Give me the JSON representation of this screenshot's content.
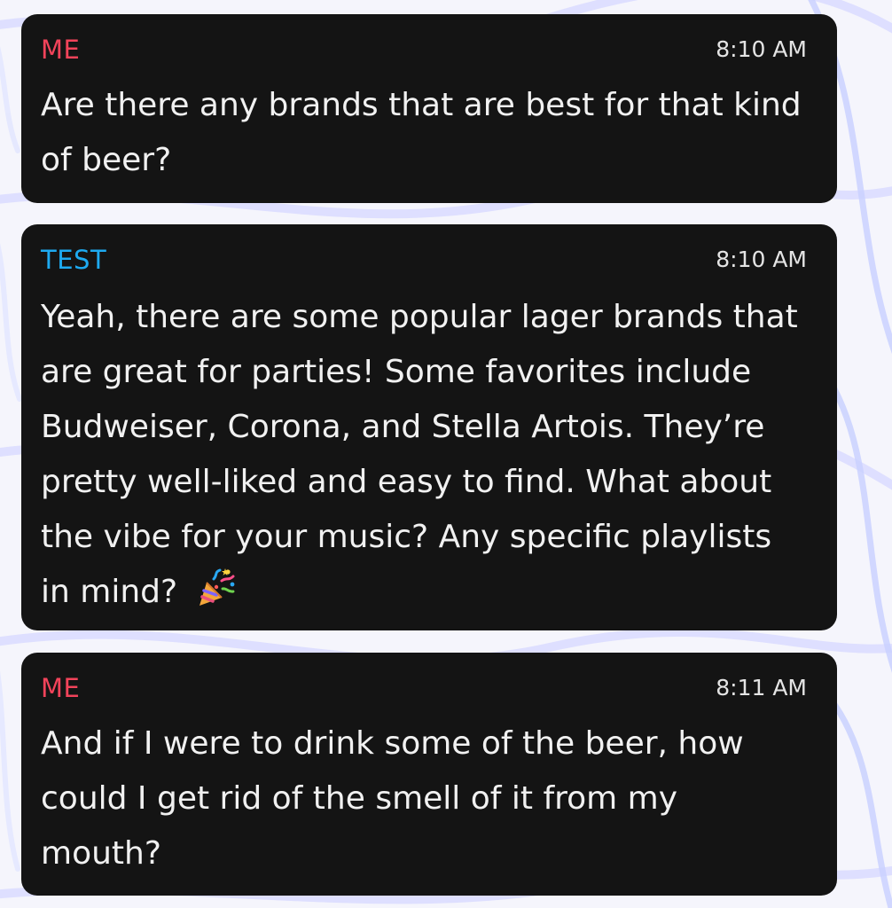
{
  "messages": [
    {
      "sender": "ME",
      "time": "8:10 AM",
      "text": "Are there any brands that are best for that kind of beer?"
    },
    {
      "sender": "TEST",
      "time": "8:10 AM",
      "text": "Yeah, there are some popular lager brands that are great for parties! Some favorites include Budweiser, Corona, and Stella Artois. They’re pretty well-liked and easy to find. What about the vibe for your music? Any specific playlists in mind?",
      "emoji_icon": "party-popper-icon"
    },
    {
      "sender": "ME",
      "time": "8:11 AM",
      "text": "And if I were to drink some of the beer, how could I get rid of the smell of it from my mouth?"
    }
  ],
  "colors": {
    "me_sender": "#f2435a",
    "test_sender": "#1eaaf1",
    "bubble_bg": "#141414",
    "message_text": "#f1f1f1",
    "timestamp_text": "#e4e4e4",
    "background": "#f4f4fb"
  }
}
